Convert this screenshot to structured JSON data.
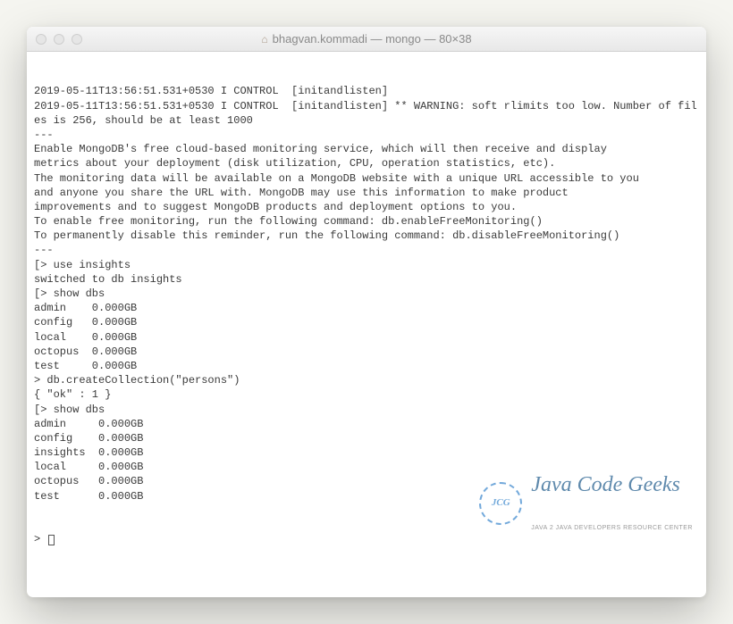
{
  "window": {
    "title": "bhagvan.kommadi — mongo — 80×38"
  },
  "terminal": {
    "lines": [
      "2019-05-11T13:56:51.531+0530 I CONTROL  [initandlisten]",
      "2019-05-11T13:56:51.531+0530 I CONTROL  [initandlisten] ** WARNING: soft rlimits too low. Number of files is 256, should be at least 1000",
      "---",
      "Enable MongoDB's free cloud-based monitoring service, which will then receive and display",
      "metrics about your deployment (disk utilization, CPU, operation statistics, etc).",
      "",
      "The monitoring data will be available on a MongoDB website with a unique URL accessible to you",
      "and anyone you share the URL with. MongoDB may use this information to make product",
      "improvements and to suggest MongoDB products and deployment options to you.",
      "",
      "To enable free monitoring, run the following command: db.enableFreeMonitoring()",
      "To permanently disable this reminder, run the following command: db.disableFreeMonitoring()",
      "---",
      "",
      "[> use insights",
      "switched to db insights",
      "[> show dbs",
      "admin    0.000GB",
      "config   0.000GB",
      "local    0.000GB",
      "octopus  0.000GB",
      "test     0.000GB",
      "> db.createCollection(\"persons\")",
      "{ \"ok\" : 1 }",
      "[> show dbs",
      "admin     0.000GB",
      "config    0.000GB",
      "insights  0.000GB",
      "local     0.000GB",
      "octopus   0.000GB",
      "test      0.000GB"
    ],
    "prompt": "> "
  },
  "watermark": {
    "circle": "JCG",
    "main": "Java Code Geeks",
    "sub": "Java 2 Java Developers Resource Center"
  }
}
